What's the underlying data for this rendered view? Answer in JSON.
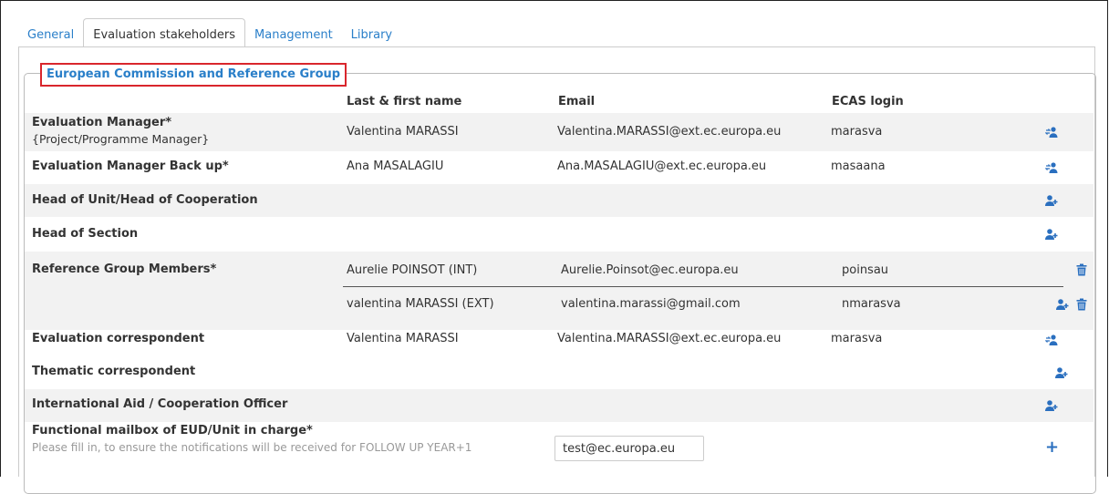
{
  "tabs": [
    {
      "label": "General",
      "active": false
    },
    {
      "label": "Evaluation stakeholders",
      "active": true
    },
    {
      "label": "Management",
      "active": false
    },
    {
      "label": "Library",
      "active": false
    }
  ],
  "group": {
    "title": "European Commission and Reference Group",
    "columns": {
      "name": "Last & first name",
      "email": "Email",
      "login": "ECAS login"
    }
  },
  "rows": {
    "eval_manager": {
      "role": "Evaluation Manager*",
      "sub": "{Project/Programme Manager}",
      "name": "Valentina MARASSI",
      "email": "Valentina.MARASSI@ext.ec.europa.eu",
      "login": "marasva",
      "icon": "user-swap-icon"
    },
    "eval_manager_backup": {
      "role": "Evaluation Manager Back up*",
      "name": "Ana MASALAGIU",
      "email": "Ana.MASALAGIU@ext.ec.europa.eu",
      "login": "masaana",
      "icon": "user-swap-icon"
    },
    "head_unit": {
      "role": "Head of Unit/Head of Cooperation",
      "icon": "user-add-icon"
    },
    "head_section": {
      "role": "Head of Section",
      "icon": "user-add-icon"
    },
    "ref_group": {
      "role": "Reference Group Members*",
      "members": [
        {
          "name": "Aurelie POINSOT (INT)",
          "email": "Aurelie.Poinsot@ec.europa.eu",
          "login": "poinsau"
        },
        {
          "name": "valentina MARASSI (EXT)",
          "email": "valentina.marassi@gmail.com",
          "login": "nmarasva"
        }
      ]
    },
    "eval_correspondent": {
      "role": "Evaluation correspondent",
      "name": "Valentina MARASSI",
      "email": "Valentina.MARASSI@ext.ec.europa.eu",
      "login": "marasva",
      "icon": "user-swap-icon"
    },
    "thematic": {
      "role": "Thematic correspondent",
      "icon": "user-add-icon"
    },
    "intl_aid": {
      "role": "International Aid / Cooperation Officer",
      "icon": "user-add-icon"
    },
    "mailbox": {
      "role": "Functional mailbox of EUD/Unit in charge*",
      "hint": "Please fill in, to ensure the notifications will be received for FOLLOW UP YEAR+1",
      "value": "test@ec.europa.eu",
      "icon": "plus-icon"
    }
  },
  "colors": {
    "link": "#2a7fc9",
    "icon": "#2a6fbf",
    "highlight": "#d9262c",
    "shade": "#f2f2f2"
  }
}
